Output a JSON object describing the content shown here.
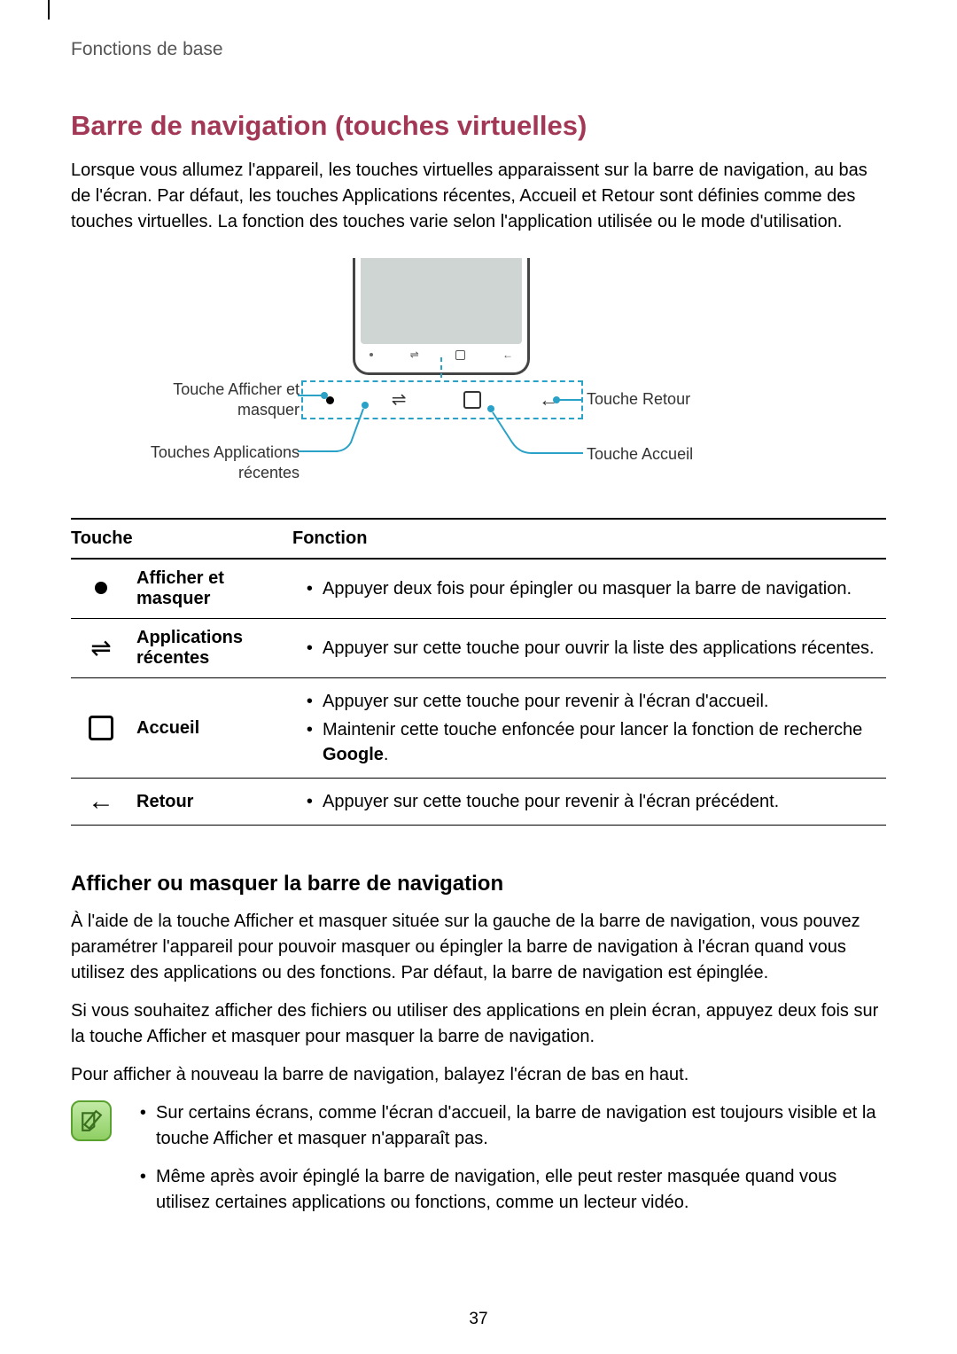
{
  "header": {
    "breadcrumb": "Fonctions de base"
  },
  "title": "Barre de navigation (touches virtuelles)",
  "intro": "Lorsque vous allumez l'appareil, les touches virtuelles apparaissent sur la barre de navigation, au bas de l'écran. Par défaut, les touches Applications récentes, Accueil et Retour sont définies comme des touches virtuelles. La fonction des touches varie selon l'application utilisée ou le mode d'utilisation.",
  "diagram": {
    "callout_show_hide": "Touche Afficher et masquer",
    "callout_recents": "Touches Applications récentes",
    "callout_back": "Touche Retour",
    "callout_home": "Touche Accueil"
  },
  "table": {
    "col_key": "Touche",
    "col_fn": "Fonction",
    "rows": [
      {
        "name": "Afficher et masquer",
        "fn": [
          "Appuyer deux fois pour épingler ou masquer la barre de navigation."
        ]
      },
      {
        "name": "Applications récentes",
        "fn": [
          "Appuyer sur cette touche pour ouvrir la liste des applications récentes."
        ]
      },
      {
        "name": "Accueil",
        "fn": [
          "Appuyer sur cette touche pour revenir à l'écran d'accueil.",
          "Maintenir cette touche enfoncée pour lancer la fonction de recherche Google."
        ]
      },
      {
        "name": "Retour",
        "fn": [
          "Appuyer sur cette touche pour revenir à l'écran précédent."
        ]
      }
    ]
  },
  "section2": {
    "heading": "Afficher ou masquer la barre de navigation",
    "p1": "À l'aide de la touche Afficher et masquer située sur la gauche de la barre de navigation, vous pouvez paramétrer l'appareil pour pouvoir masquer ou épingler la barre de navigation à l'écran quand vous utilisez des applications ou des fonctions. Par défaut, la barre de navigation est épinglée.",
    "p2": "Si vous souhaitez afficher des fichiers ou utiliser des applications en plein écran, appuyez deux fois sur la touche Afficher et masquer pour masquer la barre de navigation.",
    "p3": "Pour afficher à nouveau la barre de navigation, balayez l'écran de bas en haut."
  },
  "notes": [
    "Sur certains écrans, comme l'écran d'accueil, la barre de navigation est toujours visible et la touche Afficher et masquer n'apparaît pas.",
    "Même après avoir épinglé la barre de navigation, elle peut rester masquée quand vous utilisez certaines applications ou fonctions, comme un lecteur vidéo."
  ],
  "page_number": "37"
}
